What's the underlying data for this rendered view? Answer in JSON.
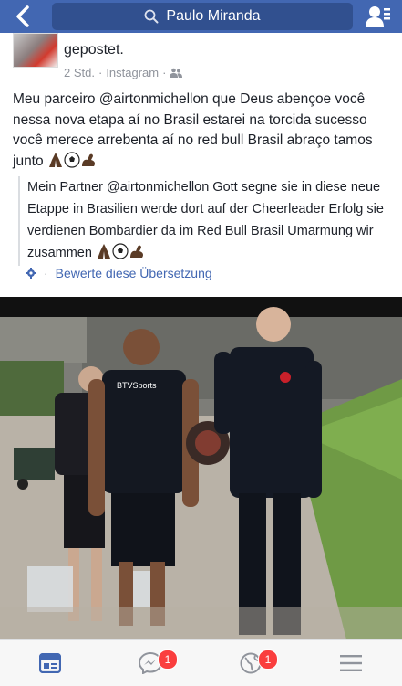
{
  "navbar": {
    "search_text": "Paulo Miranda"
  },
  "post": {
    "author_line_fragment": "gepostet.",
    "time": "2 Std.",
    "source": "Instagram",
    "text": "Meu parceiro @airtonmichellon que Deus abençoe você nessa nova etapa aí no Brasil estarei na torcida sucesso você merece arrebenta aí no red bull Brasil abraço tamos junto",
    "translation": "Mein Partner @airtonmichellon Gott segne sie in diese neue Etappe in Brasilien werde dort auf der Cheerleader Erfolg sie verdienen Bombardier da im Red Bull Brasil Umarmung wir zusammen",
    "rate_translation": "Bewerte diese Übersetzung",
    "emojis": [
      "praying-hands-icon",
      "soccer-ball-icon",
      "flexed-biceps-icon"
    ]
  },
  "photo": {
    "shirt_text": "BTVSports"
  },
  "tabbar": {
    "messages_badge": "1",
    "notifications_badge": "1"
  },
  "colors": {
    "brand": "#4267b2",
    "badge": "#fa3e3e",
    "link": "#4267b2"
  }
}
